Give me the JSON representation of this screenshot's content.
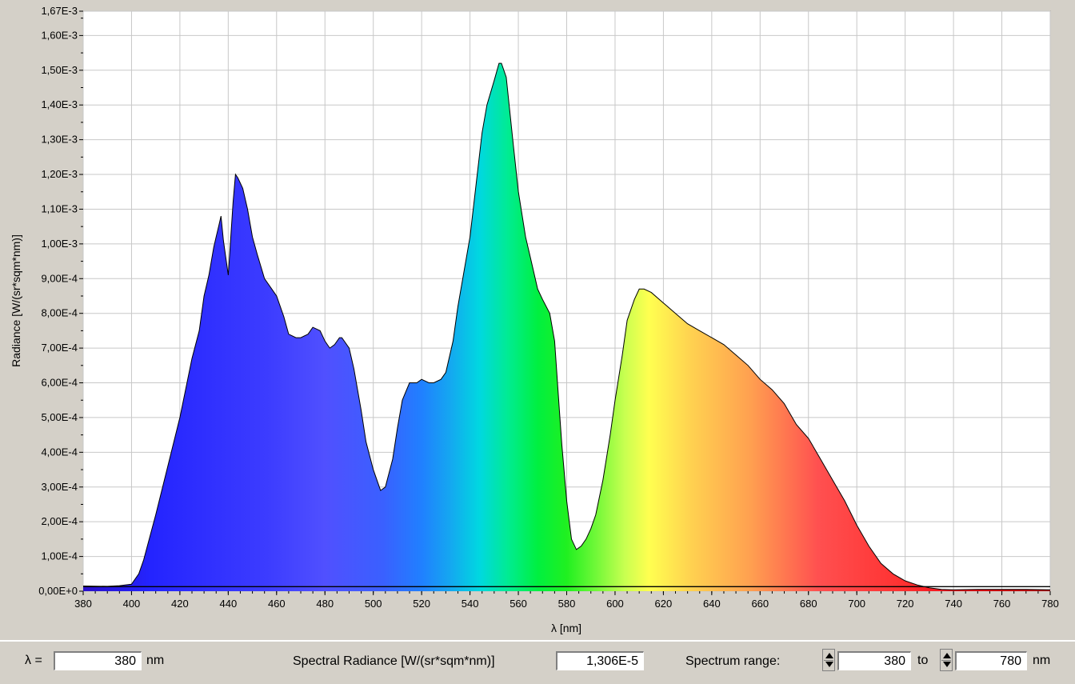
{
  "chart_data": {
    "type": "area",
    "xlabel": "λ [nm]",
    "ylabel": "Radiance [W/(sr*sqm*nm)]",
    "xlim": [
      380,
      780
    ],
    "ylim": [
      0,
      0.00167
    ],
    "x_ticks": [
      "380",
      "400",
      "420",
      "440",
      "460",
      "480",
      "500",
      "520",
      "540",
      "560",
      "580",
      "600",
      "620",
      "640",
      "660",
      "680",
      "700",
      "720",
      "740",
      "760",
      "780"
    ],
    "y_ticks": [
      {
        "label": "0,00E+0",
        "value": 0
      },
      {
        "label": "1,00E-4",
        "value": 0.0001
      },
      {
        "label": "2,00E-4",
        "value": 0.0002
      },
      {
        "label": "3,00E-4",
        "value": 0.0003
      },
      {
        "label": "4,00E-4",
        "value": 0.0004
      },
      {
        "label": "5,00E-4",
        "value": 0.0005
      },
      {
        "label": "6,00E-4",
        "value": 0.0006
      },
      {
        "label": "7,00E-4",
        "value": 0.0007
      },
      {
        "label": "8,00E-4",
        "value": 0.0008
      },
      {
        "label": "9,00E-4",
        "value": 0.0009
      },
      {
        "label": "1,00E-3",
        "value": 0.001
      },
      {
        "label": "1,10E-3",
        "value": 0.0011
      },
      {
        "label": "1,20E-3",
        "value": 0.0012
      },
      {
        "label": "1,30E-3",
        "value": 0.0013
      },
      {
        "label": "1,40E-3",
        "value": 0.0014
      },
      {
        "label": "1,50E-3",
        "value": 0.0015
      },
      {
        "label": "1,60E-3",
        "value": 0.0016
      },
      {
        "label": "1,67E-3",
        "value": 0.00167
      }
    ],
    "grid": true,
    "fill": "visible-spectrum gradient",
    "baseline_value": 1.31e-05,
    "x": [
      380,
      390,
      395,
      400,
      403,
      405,
      410,
      415,
      420,
      425,
      428,
      430,
      432,
      434,
      435,
      436,
      437,
      438,
      440,
      442,
      443,
      444,
      446,
      448,
      450,
      452,
      455,
      458,
      460,
      463,
      465,
      468,
      470,
      473,
      475,
      478,
      480,
      482,
      484,
      486,
      487,
      490,
      492,
      495,
      497,
      500,
      503,
      505,
      508,
      510,
      512,
      515,
      518,
      520,
      523,
      525,
      528,
      530,
      533,
      535,
      540,
      545,
      547,
      550,
      552,
      553,
      555,
      558,
      560,
      563,
      565,
      568,
      570,
      573,
      575,
      577,
      578,
      580,
      582,
      584,
      586,
      588,
      590,
      592,
      595,
      598,
      600,
      603,
      605,
      608,
      610,
      612,
      615,
      620,
      625,
      630,
      635,
      640,
      645,
      650,
      655,
      660,
      665,
      670,
      675,
      680,
      685,
      690,
      695,
      700,
      705,
      710,
      715,
      720,
      725,
      730,
      735,
      740,
      750,
      760,
      770,
      780
    ],
    "y": [
      1.5e-05,
      1.4e-05,
      1.6e-05,
      2e-05,
      5e-05,
      9e-05,
      0.00022,
      0.00036,
      0.0005,
      0.00067,
      0.00075,
      0.00085,
      0.00091,
      0.00099,
      0.00102,
      0.00105,
      0.00108,
      0.00101,
      0.00091,
      0.00112,
      0.0012,
      0.00119,
      0.00116,
      0.0011,
      0.00102,
      0.00097,
      0.0009,
      0.00087,
      0.00085,
      0.00079,
      0.00074,
      0.00073,
      0.00073,
      0.00074,
      0.00076,
      0.00075,
      0.00072,
      0.0007,
      0.00071,
      0.00073,
      0.00073,
      0.0007,
      0.00064,
      0.00052,
      0.00043,
      0.00035,
      0.00029,
      0.0003,
      0.00038,
      0.00047,
      0.00055,
      0.0006,
      0.0006,
      0.00061,
      0.0006,
      0.0006,
      0.00061,
      0.00063,
      0.00072,
      0.00082,
      0.00102,
      0.00132,
      0.0014,
      0.00147,
      0.00152,
      0.00152,
      0.00148,
      0.00128,
      0.00115,
      0.00102,
      0.00096,
      0.00087,
      0.00084,
      0.0008,
      0.00072,
      0.00052,
      0.00042,
      0.00026,
      0.00015,
      0.00012,
      0.00013,
      0.00015,
      0.00018,
      0.00022,
      0.00032,
      0.00045,
      0.00055,
      0.00068,
      0.00078,
      0.00084,
      0.00087,
      0.00087,
      0.00086,
      0.00083,
      0.0008,
      0.00077,
      0.00075,
      0.00073,
      0.00071,
      0.00068,
      0.00065,
      0.00061,
      0.00058,
      0.00054,
      0.00048,
      0.00044,
      0.00038,
      0.00032,
      0.00026,
      0.00019,
      0.00013,
      8e-05,
      5e-05,
      3e-05,
      1.8e-05,
      1e-05,
      5e-06,
      4e-06,
      5e-06,
      5e-06,
      5e-06,
      4e-06
    ]
  },
  "controls": {
    "lambda_label": "λ =",
    "lambda_value": "380",
    "lambda_unit": "nm",
    "radiance_label": "Spectral Radiance [W/(sr*sqm*nm)]",
    "radiance_value": "1,306E-5",
    "range_label": "Spectrum range:",
    "range_from": "380",
    "range_to_label": "to",
    "range_to": "780",
    "range_unit": "nm"
  }
}
